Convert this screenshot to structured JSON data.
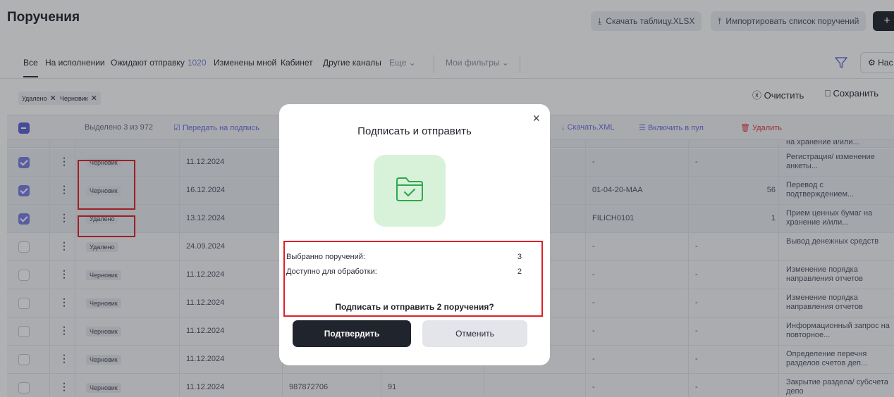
{
  "header": {
    "title": "Поручения",
    "download_xlsx": "Скачать таблицу.XLSX",
    "import_list": "Импортировать список поручений",
    "add_symbol": "+"
  },
  "tabs": [
    {
      "label": "Все",
      "active": true
    },
    {
      "label": "На исполнении"
    },
    {
      "label": "Ожидают отправку",
      "count": "1020"
    },
    {
      "label": "Изменены мной"
    },
    {
      "label": "Кабинет"
    },
    {
      "label": "Другие каналы"
    },
    {
      "label": "Еще"
    },
    {
      "label": "Мои фильтры"
    }
  ],
  "settings_label": "Нас",
  "chips": [
    "Удалено",
    "Черновик"
  ],
  "clear_label": "Очистить",
  "save_label": "Сохранить",
  "toolbar": {
    "selected": "Выделено 3 из 972",
    "send_to_sign": "Передать на подпись",
    "download_xml": "Скачать.XML",
    "add_to_pool": "Включить в пул",
    "delete": "Удалить"
  },
  "partial_row_text": "на хранение и/или...",
  "rows": [
    {
      "checked": true,
      "status": "Черновик",
      "date": "11.12.2024",
      "c3": "",
      "c4": "",
      "c5": "-",
      "c6": "-",
      "c7": "",
      "desc": "Регистрация/ изменение анкеты..."
    },
    {
      "checked": true,
      "status": "Черновик",
      "date": "16.12.2024",
      "c3": "",
      "c4": "",
      "c5": "01-04-20-MAA",
      "c6": "",
      "c7": "56",
      "desc": "Перевод с подтверждением..."
    },
    {
      "checked": true,
      "status": "Удалено",
      "date": "13.12.2024",
      "c3": "",
      "c4": "",
      "c5": "FILICH0101",
      "c6": "",
      "c7": "1",
      "desc": "Прием ценных бумаг на хранение и/или..."
    },
    {
      "checked": false,
      "status": "Удалено",
      "date": "24.09.2024",
      "c3": "",
      "c4": "",
      "c5": "-",
      "c6": "-",
      "c7": "",
      "desc": "Вывод денежных средств"
    },
    {
      "checked": false,
      "status": "Черновик",
      "date": "11.12.2024",
      "c3": "",
      "c4": "",
      "c5": "-",
      "c6": "-",
      "c7": "",
      "desc": "Изменение порядка направления отчетов"
    },
    {
      "checked": false,
      "status": "Черновик",
      "date": "11.12.2024",
      "c3": "",
      "c4": "",
      "c5": "-",
      "c6": "-",
      "c7": "",
      "desc": "Изменение порядка направления отчетов"
    },
    {
      "checked": false,
      "status": "Черновик",
      "date": "11.12.2024",
      "c3": "",
      "c4": "",
      "c5": "-",
      "c6": "-",
      "c7": "",
      "desc": "Информационный запрос на повторное..."
    },
    {
      "checked": false,
      "status": "Черновик",
      "date": "11.12.2024",
      "c3": "",
      "c4": "",
      "c5": "-",
      "c6": "-",
      "c7": "",
      "desc": "Определение перечня разделов счетов деп..."
    },
    {
      "checked": false,
      "status": "Черновик",
      "date": "11.12.2024",
      "c3": "987872706",
      "c4": "91",
      "c5": "-",
      "c6": "-",
      "c7": "",
      "desc": "Закрытие раздела/ субсчета депо"
    }
  ],
  "modal": {
    "close": "×",
    "title": "Подписать и отправить",
    "selected_label": "Выбранно поручений:",
    "selected_value": "3",
    "available_label": "Доступно для обработки:",
    "available_value": "2",
    "question": "Подписать и отправить 2 поручения?",
    "confirm": "Подтвердить",
    "cancel": "Отменить"
  },
  "colors": {
    "accent": "#7b7fe6",
    "primary_dark": "#20242c",
    "danger": "#e23b3b",
    "highlight_box": "#e01f26",
    "folder_tile": "#d8f2d9",
    "folder_icon": "#2fa84f"
  },
  "icons": [
    "download-icon",
    "upload-icon",
    "plus-icon",
    "chevron-down-icon",
    "filter-icon",
    "gear-icon",
    "close-icon",
    "clear-circle-icon",
    "bookmark-icon",
    "send-sign-icon",
    "xml-download-icon",
    "list-pool-icon",
    "trash-icon",
    "more-vertical-icon",
    "folder-check-icon"
  ]
}
